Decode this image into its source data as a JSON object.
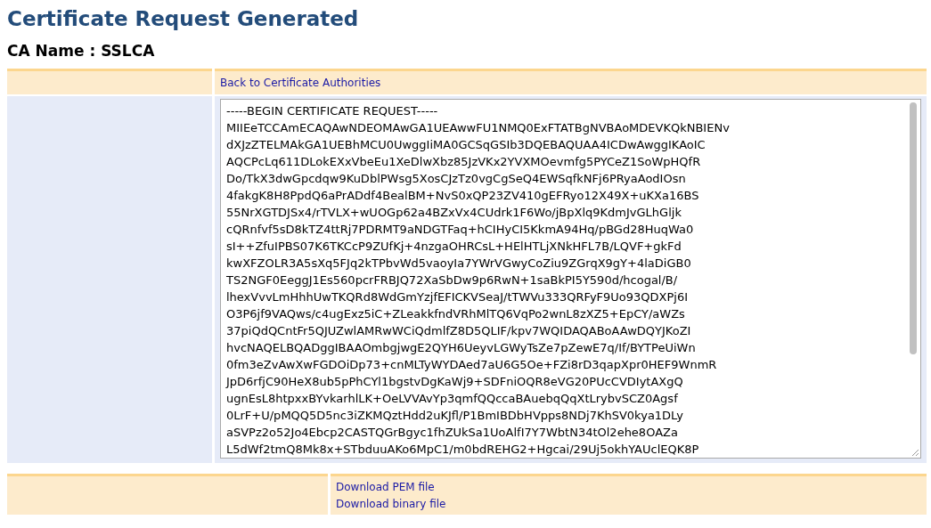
{
  "title": "Certificate Request Generated",
  "ca_name": "CA Name : SSLCA",
  "back_link": "Back to Certificate Authorities",
  "certificate_request": {
    "lines": [
      "-----BEGIN CERTIFICATE REQUEST-----",
      "MIIEeTCCAmECAQAwNDEOMAwGA1UEAwwFU1NMQ0ExFTATBgNVBAoMDEVKQkNBIENv",
      "dXJzZTELMAkGA1UEBhMCU0UwggIiMA0GCSqGSIb3DQEBAQUAA4ICDwAwggIKAoIC",
      "AQCPcLq611DLokEXxVbeEu1XeDlwXbz85JzVKx2YVXMOevmfg5PYCeZ1SoWpHQfR",
      "Do/TkX3dwGpcdqw9KuDblPWsg5XosCJzTz0vgCgSeQ4EWSqfkNFj6PRyaAodIOsn",
      "4fakgK8H8PpdQ6aPrADdf4BealBM+NvS0xQP23ZV410gEFRyo12X49X+uKXa16BS",
      "55NrXGTDJSx4/rTVLX+wUOGp62a4BZxVx4CUdrk1F6Wo/jBpXlq9KdmJvGLhGljk",
      "cQRnfvf5sD8kTZ4ttRj7PDRMT9aNDGTFaq+hCIHyCI5KkmA94Hq/pBGd28HuqWa0",
      "sI++ZfuIPBS07K6TKCcP9ZUfKj+4nzgaOHRCsL+HElHTLjXNkHFL7B/LQVF+gkFd",
      "kwXFZOLR3A5sXq5FJq2kTPbvWd5vaoyIa7YWrVGwyCoZiu9ZGrqX9gY+4laDiGB0",
      "TS2NGF0EeggJ1Es560pcrFRBJQ72XaSbDw9p6RwN+1saBkPI5Y590d/hcogal/B/",
      "lhexVvvLmHhhUwTKQRd8WdGmYzjfEFICKVSeaJ/tTWVu333QRFyF9Uo93QDXPj6I",
      "O3P6jf9VAQws/c4ugExz5iC+ZLeakkfndVRhMlTQ6VqPo2wnL8zXZ5+EpCY/aWZs",
      "37piQdQCntFr5QJUZwlAMRwWCiQdmlfZ8D5QLIF/kpv7WQIDAQABoAAwDQYJKoZI",
      "hvcNAQELBQADggIBAAOmbgjwgE2QYH6UeyvLGWyTsZe7pZewE7q/If/BYTPeUiWn",
      "0fm3eZvAwXwFGDOiDp73+cnMLTyWYDAed7aU6G5Oe+FZi8rD3qapXpr0HEF9WnmR",
      "JpD6rfjC90HeX8ub5pPhCYl1bgstvDgKaWj9+SDFniOQR8eVG20PUcCVDIytAXgQ",
      "ugnEsL8htpxxBYvkarhlLK+OeLVVAvYp3qmfQQccaBAuebqQqXtLrybvSCZ0Agsf",
      "0LrF+U/pMQQ5D5nc3iZKMQztHdd2uKJfl/P1BmIBDbHVpps8NDj7KhSV0kya1DLy",
      "aSVPz2o52Jo4Ebcp2CASTQGrBgyc1fhZUkSa1UoAlfI7Y7WbtN34tOl2ehe8OAZa",
      "L5dWf2tmQ8Mk8x+STbduuAKo6MpC1/m0bdREHG2+Hgcai/29Uj5okhYAUclEQK8P"
    ]
  },
  "downloads": [
    "Download PEM file",
    "Download binary file"
  ]
}
